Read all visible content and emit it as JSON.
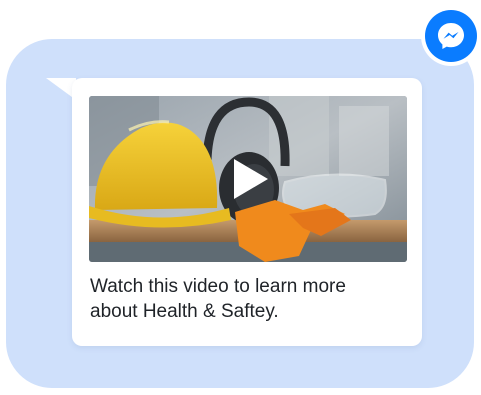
{
  "message": {
    "caption_line1": "Watch this video to learn more",
    "caption_line2": "about Health & Saftey."
  },
  "video": {
    "thumbnail_subject": "hard-hat-earmuffs-gloves-goggles",
    "play_icon": "play-icon"
  },
  "app_badge": {
    "icon": "messenger-icon"
  },
  "colors": {
    "outer_bubble": "#cfe0fb",
    "card": "#ffffff",
    "messenger_blue": "#0a7cff",
    "text": "#1f2328"
  }
}
